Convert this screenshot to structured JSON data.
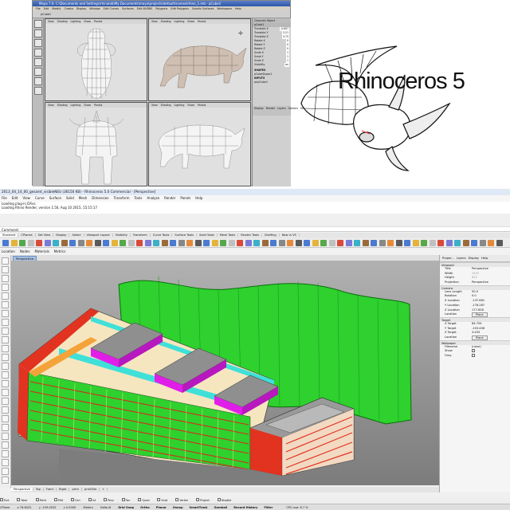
{
  "maya": {
    "title": "Maya 7.0: C:\\Documents and Settings\\rhinolab\\My Documents\\maya\\projects\\default\\scenes\\rhino_1.mb - pCube1",
    "menus": [
      "File",
      "Edit",
      "Modify",
      "Create",
      "Display",
      "Window",
      "Edit Curves",
      "Surfaces",
      "Edit NURBS",
      "Polygons",
      "Edit Polygons",
      "Subdiv Surfaces",
      "Workspace",
      "Help"
    ],
    "status": "pCube1",
    "viewport_menu": [
      "View",
      "Shading",
      "Lighting",
      "Show",
      "Panels"
    ],
    "side_header": "Channels Object",
    "side_title": "pCube1",
    "attributes": [
      {
        "k": "Translate X",
        "v": "-0.807"
      },
      {
        "k": "Translate Y",
        "v": "3.21"
      },
      {
        "k": "Translate Z",
        "v": "4.75"
      },
      {
        "k": "Rotate X",
        "v": "0"
      },
      {
        "k": "Rotate Y",
        "v": "0"
      },
      {
        "k": "Rotate Z",
        "v": "0"
      },
      {
        "k": "Scale X",
        "v": "1"
      },
      {
        "k": "Scale Y",
        "v": "1"
      },
      {
        "k": "Scale Z",
        "v": "1"
      },
      {
        "k": "Visibility",
        "v": "on"
      }
    ],
    "shapes": [
      "SHAPES",
      "pCubeShape1",
      "INPUTS",
      "polyCube1"
    ],
    "side_footer": [
      "Display",
      "Render",
      "Layers",
      "Options",
      "Help"
    ]
  },
  "logo": {
    "name": "Rhinoceros",
    "version": "5"
  },
  "rhino": {
    "title": "2013_04_14_00_gesamt_visibleNEU (36150 KB) - Rhinoceros 5.0 Commercial - [Perspective]",
    "menus": [
      "File",
      "Edit",
      "View",
      "Curve",
      "Surface",
      "Solid",
      "Mesh",
      "Dimension",
      "Transform",
      "Tools",
      "Analyze",
      "Render",
      "Panels",
      "Help"
    ],
    "command_history": [
      "Loading plug-in DXvs.",
      "Loading Rhino Render, version 1.50, Aug 10 2015, 15:15:17"
    ],
    "command_prompt": "Command:",
    "tabs": [
      "Standard",
      "CPlanes",
      "Set View",
      "Display",
      "Select",
      "Viewport Layout",
      "Visibility",
      "Transform",
      "Curve Tools",
      "Surface Tools",
      "Solid Tools",
      "Mesh Tools",
      "Render Tools",
      "Drafting",
      "New in V5"
    ],
    "layer_bar": [
      "Location",
      "Nodes",
      "Materials",
      "Metrics"
    ],
    "viewport_name": "Perspective",
    "viewport_tabs": [
      "Perspective",
      "Top",
      "Front",
      "Right",
      "print",
      "print30a",
      "+"
    ],
    "osnaps": [
      "End",
      "Near",
      "Point",
      "Mid",
      "Cen",
      "Int",
      "Perp",
      "Tan",
      "Quad",
      "Knot",
      "Vertex",
      "Project",
      "Disable"
    ],
    "status": {
      "cplane": "CPlane",
      "x": "x 76.8431",
      "y": "y -159.0032",
      "z": "z 0.0000",
      "units": "Meters",
      "layer": "Default",
      "toggles": [
        "Grid Snap",
        "Ortho",
        "Planar",
        "Osnap",
        "SmartTrack",
        "Gumball",
        "Record History",
        "Filter"
      ],
      "cpu": "CPU use: 6.7 %"
    },
    "panel": {
      "tabs": [
        "Proper...",
        "Layers",
        "Display",
        "Help"
      ],
      "sections": [
        {
          "title": "Viewport",
          "rows": [
            {
              "k": "Title",
              "v": "Perspective"
            },
            {
              "k": "Width",
              "v": "1552",
              "dim": true
            },
            {
              "k": "Height",
              "v": "822",
              "dim": true
            },
            {
              "k": "Projection",
              "v": "Perspective"
            }
          ]
        },
        {
          "title": "Camera",
          "rows": [
            {
              "k": "Lens Length",
              "v": "50.0"
            },
            {
              "k": "Rotation",
              "v": "0.0"
            },
            {
              "k": "X Location",
              "v": "-137.681"
            },
            {
              "k": "Y Location",
              "v": "-176.287"
            },
            {
              "k": "Z Location",
              "v": "177.658"
            },
            {
              "k": "Location",
              "v": "Place",
              "btn": true
            }
          ]
        },
        {
          "title": "Target",
          "rows": [
            {
              "k": "X Target",
              "v": "84.754"
            },
            {
              "k": "Y Target",
              "v": "-103.408"
            },
            {
              "k": "Z Target",
              "v": "3.455"
            },
            {
              "k": "Location",
              "v": "Place",
              "btn": true
            }
          ]
        },
        {
          "title": "Wallpaper",
          "rows": [
            {
              "k": "Filename",
              "v": "(none)"
            },
            {
              "k": "Show",
              "v": "",
              "chk": true
            },
            {
              "k": "Gray",
              "v": "",
              "chk": true
            }
          ]
        }
      ]
    }
  },
  "colors": {
    "facade_green": "#2ed12e",
    "facade_red": "#e23320",
    "accent_magenta": "#e01ee8",
    "roof_gray": "#8f8f8f",
    "viewport_bg": "#9a9a9a"
  }
}
